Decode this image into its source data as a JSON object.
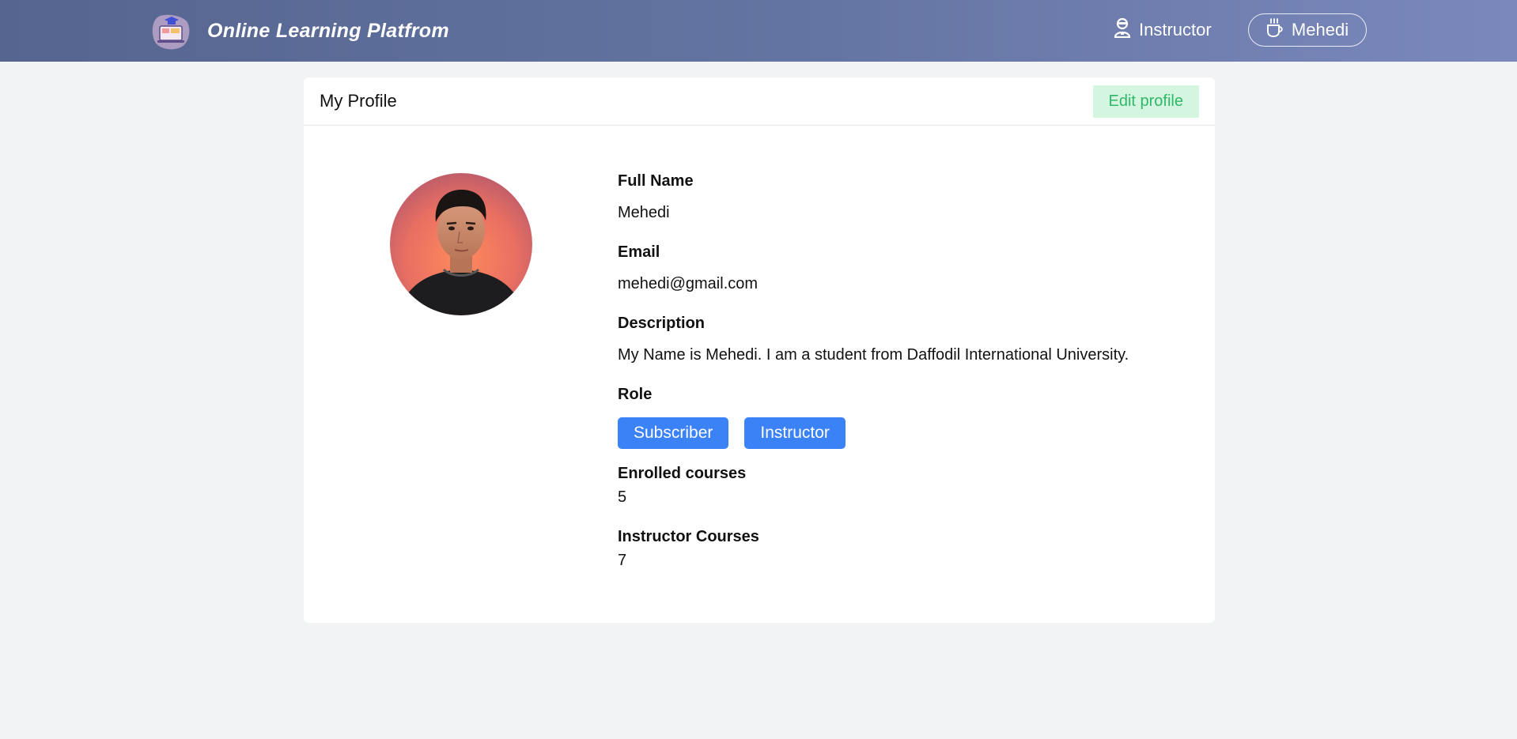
{
  "header": {
    "brand_title": "Online Learning Platfrom",
    "instructor_link": "Instructor",
    "user_name": "Mehedi"
  },
  "profile": {
    "card_title": "My Profile",
    "edit_button": "Edit profile",
    "full_name_label": "Full Name",
    "full_name": "Mehedi",
    "email_label": "Email",
    "email": "mehedi@gmail.com",
    "description_label": "Description",
    "description": "My Name is Mehedi. I am a student from Daffodil International University.",
    "role_label": "Role",
    "roles": [
      "Subscriber",
      "Instructor"
    ],
    "enrolled_label": "Enrolled courses",
    "enrolled_count": "5",
    "instructor_courses_label": "Instructor Courses",
    "instructor_courses_count": "7"
  },
  "colors": {
    "header_start": "#55658f",
    "header_end": "#7a88bc",
    "primary": "#3b82f6",
    "success_bg": "#d4f5df",
    "success_text": "#2fb86a",
    "page_bg": "#f2f3f5"
  },
  "icons": {
    "logo": "laptop-graduation-logo",
    "instructor": "user-icon",
    "user": "coffee-cup-icon"
  }
}
